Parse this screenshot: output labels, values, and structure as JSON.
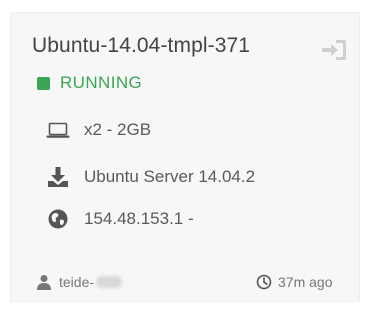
{
  "vm": {
    "name": "Ubuntu-14.04-tmpl-371",
    "status": "RUNNING",
    "status_color": "#3aa655",
    "console_icon": "sign-in-icon",
    "capacity": "x2 - 2GB",
    "capacity_icon": "laptop-icon",
    "image": "Ubuntu Server 14.04.2",
    "image_icon": "download-icon",
    "ip": "154.48.153.1 -",
    "ip_icon": "globe-icon"
  },
  "footer": {
    "owner": "teide-",
    "owner_icon": "user-icon",
    "time": "37m ago",
    "time_icon": "clock-icon"
  }
}
